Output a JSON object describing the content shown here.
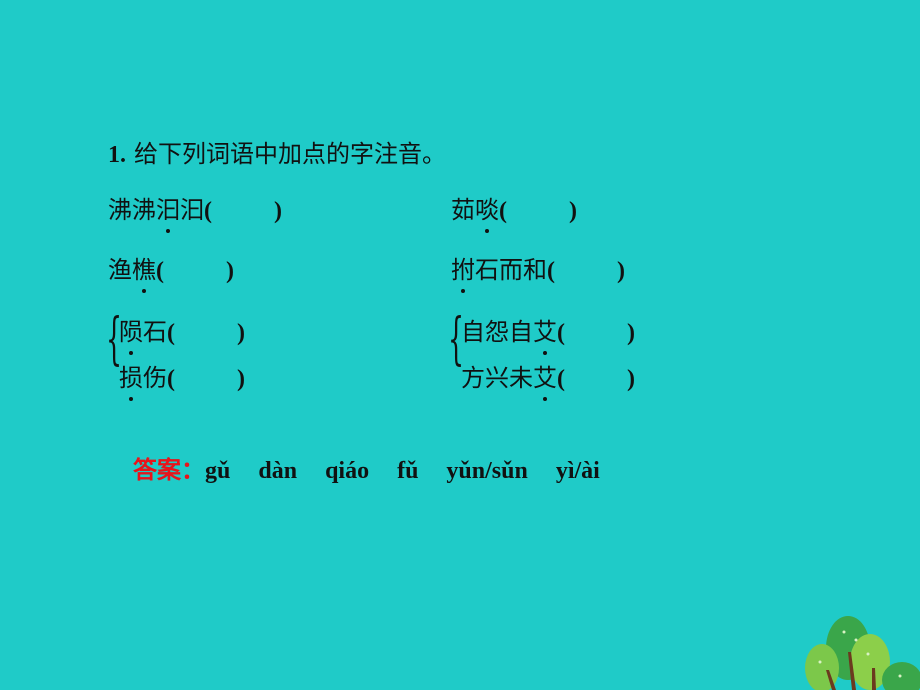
{
  "question": {
    "number": "1.",
    "prompt": "给下列词语中加点的字注音。"
  },
  "items": {
    "r1_left": {
      "before": "沸沸",
      "dotted": "汩",
      "after": "汩",
      "open": "(",
      "close": ")"
    },
    "r1_right": {
      "before": "茹",
      "dotted": "啖",
      "after": "",
      "open": "(",
      "close": ")"
    },
    "r2_left": {
      "before": "渔",
      "dotted": "樵",
      "after": "",
      "open": "(",
      "close": ")"
    },
    "r2_right": {
      "before": "",
      "dotted": "拊",
      "after": "石而和",
      "open": "(",
      "close": ")"
    },
    "g1_a": {
      "before": "",
      "dotted": "陨",
      "after": "石",
      "open": "(",
      "close": ")"
    },
    "g1_b": {
      "before": "",
      "dotted": "损",
      "after": "伤",
      "open": "(",
      "close": ")"
    },
    "g2_a": {
      "before": "自怨自",
      "dotted": "艾",
      "after": "",
      "open": "(",
      "close": ")"
    },
    "g2_b": {
      "before": "方兴未",
      "dotted": "艾",
      "after": "",
      "open": "(",
      "close": ")"
    }
  },
  "brace_char": "{",
  "answer": {
    "label": "答案：",
    "values": [
      "gǔ",
      "dàn",
      "qiáo",
      "fǔ",
      "yǔn/sǔn",
      "yì/ài"
    ]
  }
}
